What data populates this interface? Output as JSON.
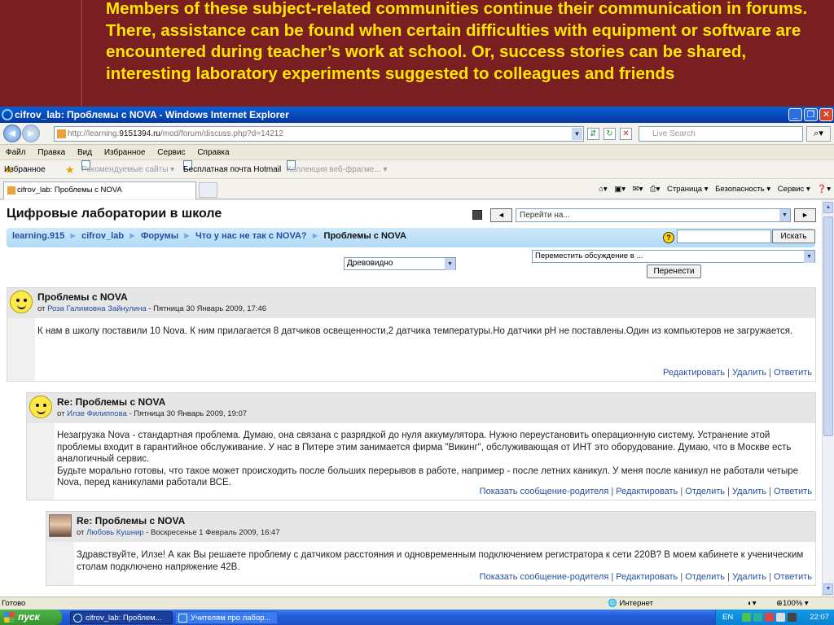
{
  "slide": {
    "text": "Members of these subject-related communities continue their communication in forums. There, assistance can be found when certain difficulties with equipment or software are encountered during teacher’s work at school. Or, success stories can be shared, interesting laboratory experiments suggested to colleagues and friends"
  },
  "browser": {
    "title": "cifrov_lab: Проблемы с NOVA - Windows Internet Explorer",
    "address_prefix": "http://learning.",
    "address_host": "9151394.ru",
    "address_path": "/mod/forum/discuss.php?d=14212",
    "search_placeholder": "Live Search",
    "menu": [
      "Файл",
      "Правка",
      "Вид",
      "Избранное",
      "Сервис",
      "Справка"
    ],
    "favorites_label": "Избранное",
    "fav_links": [
      "Рекомендуемые сайты ▾",
      "Бесплатная почта Hotmail",
      "Коллекция веб-фрагме... ▾"
    ],
    "tab_label": "cifrov_lab: Проблемы с NOVA",
    "cmd": [
      "Страница ▾",
      "Безопасность ▾",
      "Сервис ▾"
    ],
    "status_left": "Готово",
    "status_zone": "Интернет",
    "status_zoom": "100%"
  },
  "page": {
    "site_title": "Цифровые лаборатории в школе",
    "jump_placeholder": "Перейти на...",
    "jump_prev": "◄",
    "jump_next": "►",
    "breadcrumb": [
      {
        "label": "learning.915"
      },
      {
        "label": "cifrov_lab"
      },
      {
        "label": "Форумы"
      },
      {
        "label": "Что у нас не так с NOVA?"
      }
    ],
    "breadcrumb_current": "Проблемы с NOVA",
    "search_button": "Искать",
    "display_mode": "Древовидно",
    "move_select": "Переместить обсуждение в ...",
    "move_button": "Перенести",
    "author_prefix": "от",
    "posts": [
      {
        "subject": "Проблемы с NOVA",
        "author": "Роза Галимовна Зайнулина",
        "date": "- Пятница 30 Январь 2009, 17:46",
        "body": "К нам в школу поставили 10 Nova. К ним прилагается 8 датчиков освещенности,2 датчика температуры.Но датчики pH не поставлены.Один из компьютеров не загружается.",
        "commands": [
          "Редактировать",
          "Удалить",
          "Ответить"
        ],
        "avatar": "smiley"
      },
      {
        "subject": "Re: Проблемы с NOVA",
        "author": "Илзе Филиппова",
        "date": "- Пятница 30 Январь 2009, 19:07",
        "body_lines": [
          "Незагрузка Nova - стандартная проблема. Думаю, она связана с разрядкой до нуля аккумулятора. Нужно переустановить операционную систему. Устранение этой проблемы входит в гарантийное обслуживание. У нас в Питере этим занимается фирма \"Викинг\", обслуживающая от ИНТ это оборудование. Думаю, что в Москве есть аналогичный сервис.",
          "Будьте морально готовы, что такое может происходить после больших перерывов в работе, например - после летних каникул. У меня после каникул не работали четыре Nova, перед каникулами работали ВСЕ."
        ],
        "commands": [
          "Показать сообщение-родителя",
          "Редактировать",
          "Отделить",
          "Удалить",
          "Ответить"
        ],
        "avatar": "smiley"
      },
      {
        "subject": "Re: Проблемы с NOVA",
        "author": "Любовь Кушнир",
        "date": "- Воскресенье 1 Февраль 2009, 16:47",
        "body": "Здравствуйте, Илзе! А как Вы решаете проблему с датчиком расстояния и одновременным подключением регистратора к сети 220В? В моем кабинете к ученическим столам подключено напряжение 42В.",
        "commands": [
          "Показать сообщение-родителя",
          "Редактировать",
          "Отделить",
          "Удалить",
          "Ответить"
        ],
        "avatar": "photo"
      }
    ]
  },
  "taskbar": {
    "start": "пуск",
    "tasks": [
      "cifrov_lab: Проблем...",
      "Учителям про лабор..."
    ],
    "lang": "EN",
    "clock": "22:07"
  }
}
